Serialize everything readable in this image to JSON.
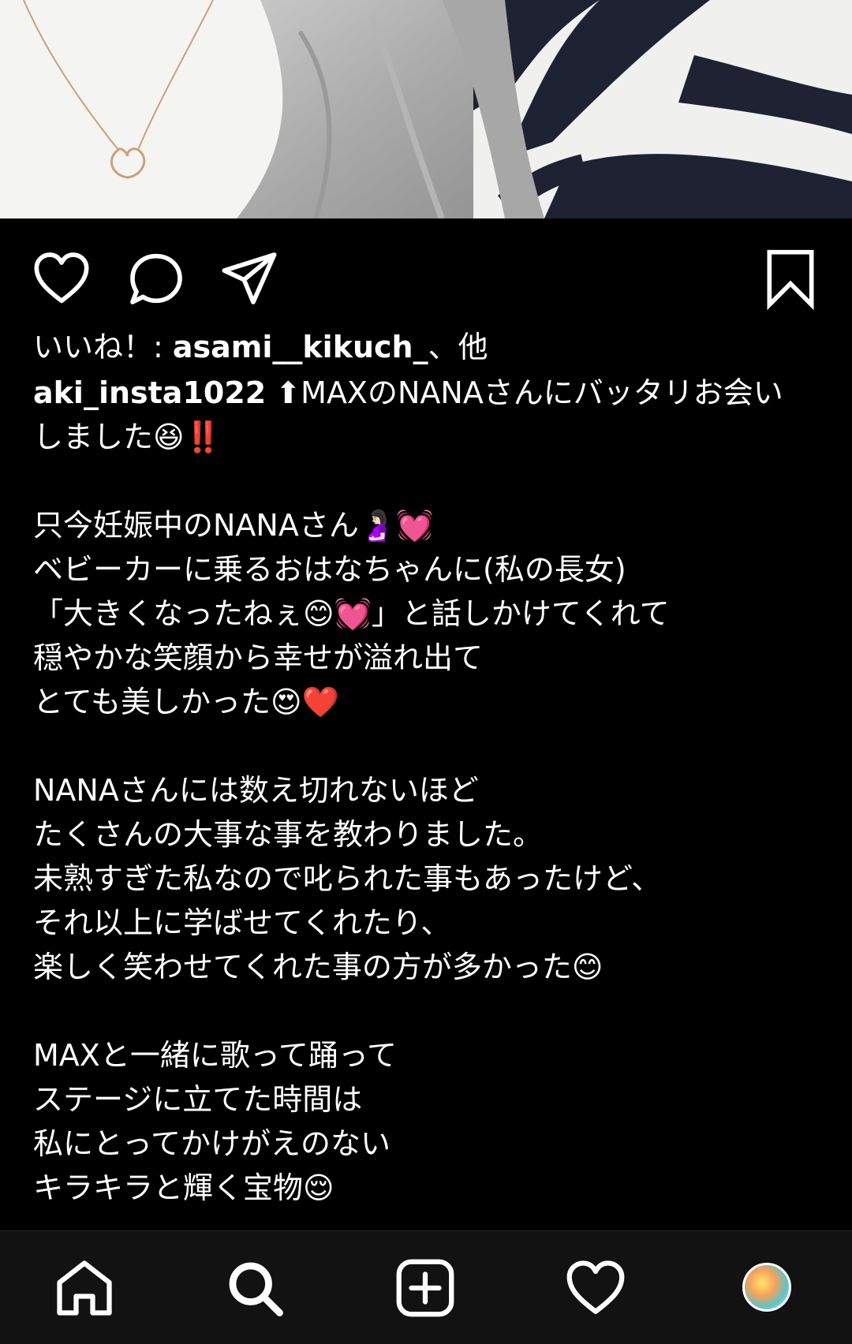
{
  "post": {
    "photo_alt": "",
    "likes": {
      "prefix": "いいね！: ",
      "user": "asami__kikuch_",
      "suffix": "、他"
    },
    "caption": {
      "author": "aki_insta1022",
      "lines": [
        "⬆MAXのNANAさんにバッタリお会い",
        "しました😆‼️",
        "",
        "只今妊娠中のNANAさん🤰🏻💓",
        "ベビーカーに乗るおはなちゃんに(私の長女)",
        "「大きくなったねぇ😊💓」と話しかけてくれて",
        "穏やかな笑顔から幸せが溢れ出て",
        "とても美しかった😍❤️",
        "",
        "NANAさんには数え切れないほど",
        "たくさんの大事な事を教わりました。",
        "未熟すぎた私なので叱られた事もあったけど、",
        "それ以上に学ばせてくれたり、",
        "楽しく笑わせてくれた事の方が多かった😊",
        "",
        "MAXと一緒に歌って踊って",
        "ステージに立てた時間は",
        "私にとってかけがえのない",
        "キラキラと輝く宝物😌"
      ]
    }
  },
  "icons": {
    "like": "heart-outline-icon",
    "comment": "comment-bubble-icon",
    "share": "paper-plane-icon",
    "save": "bookmark-icon"
  },
  "nav": {
    "home": "home-icon",
    "search": "search-icon",
    "new_post": "plus-square-icon",
    "activity": "heart-icon",
    "profile": "profile-avatar"
  },
  "colors": {
    "background": "#000000",
    "nav_background": "#121212",
    "text": "#ffffff"
  }
}
